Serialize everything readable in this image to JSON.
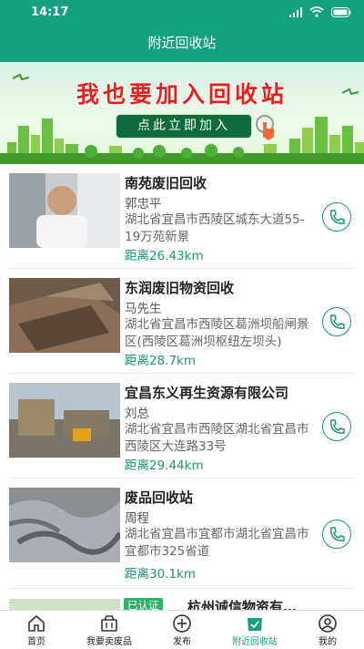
{
  "status_bar": {
    "time": "14:17"
  },
  "nav": {
    "title": "附近回收站"
  },
  "banner": {
    "headline": "我也要加入回收站",
    "join_button": "点此立即加入"
  },
  "stations": [
    {
      "name": "南苑废旧回收",
      "contact": "郭忠平",
      "address": "湖北省宜昌市西陵区城东大道55-19万苑新景",
      "distance": "距离26.43km"
    },
    {
      "name": "东润废旧物资回收",
      "contact": "马先生",
      "address": "湖北省宜昌市西陵区葛洲坝船闸景区(西陵区葛洲坝枢纽左坝头)",
      "distance": "距离28.7km"
    },
    {
      "name": "宜昌东义再生资源有限公司",
      "contact": "刘总",
      "address": "湖北省宜昌市西陵区湖北省宜昌市西陵区大连路33号",
      "distance": "距离29.44km"
    },
    {
      "name": "废品回收站",
      "contact": "周程",
      "address": "湖北省宜昌市宜都市湖北省宜昌市宜都市325省道",
      "distance": "距离30.1km"
    },
    {
      "badge": "已认证",
      "name": "杭州诚信物资有…"
    }
  ],
  "tabs": [
    {
      "label": "首页",
      "icon": "home-icon"
    },
    {
      "label": "我要卖废品",
      "icon": "basket-icon"
    },
    {
      "label": "发布",
      "icon": "plus-circle-icon"
    },
    {
      "label": "附近回收站",
      "icon": "station-icon",
      "active": true
    },
    {
      "label": "我的",
      "icon": "user-icon"
    }
  ],
  "colors": {
    "primary": "#13a17f",
    "distance": "#1a9a6a",
    "headline": "#e9201a"
  }
}
